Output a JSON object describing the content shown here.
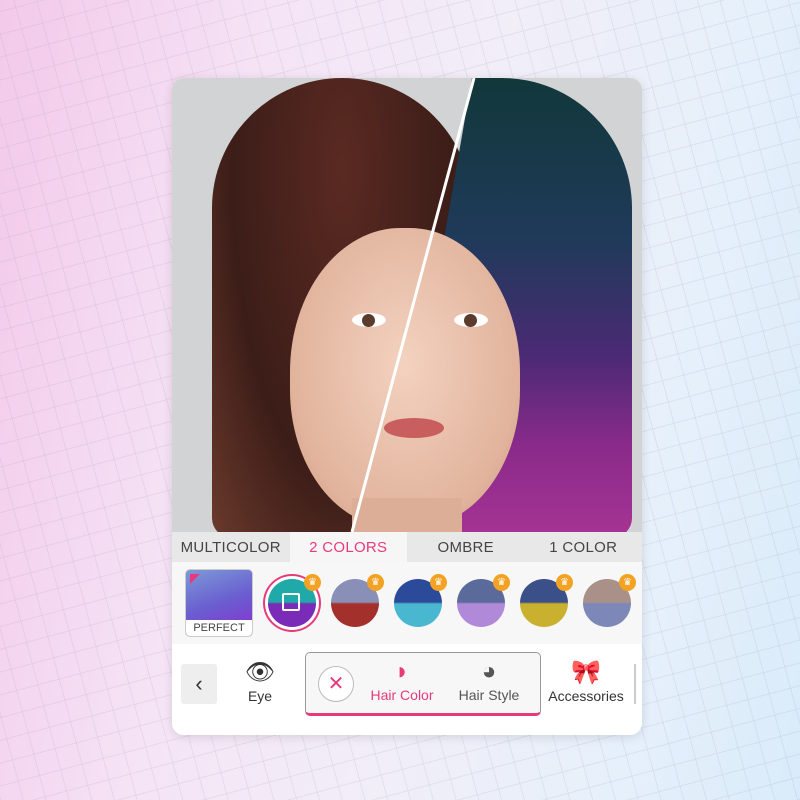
{
  "tabs": [
    {
      "label": "MULTICOLOR",
      "active": false
    },
    {
      "label": "2 COLORS",
      "active": true
    },
    {
      "label": "OMBRE",
      "active": false
    },
    {
      "label": "1 COLOR",
      "active": false
    }
  ],
  "swatches": {
    "perfect_label": "PERFECT",
    "items": [
      {
        "name": "teal-purple",
        "colors": [
          "#1fa9a8",
          "#7a2bb8"
        ],
        "premium": true,
        "selected": true
      },
      {
        "name": "lavender-red",
        "colors": [
          "#8a8fb8",
          "#a3302b"
        ],
        "premium": true,
        "selected": false
      },
      {
        "name": "blue-cyan",
        "colors": [
          "#2b4a9a",
          "#4ab7d0"
        ],
        "premium": true,
        "selected": false
      },
      {
        "name": "slate-violet",
        "colors": [
          "#5a6a9a",
          "#b08ad8"
        ],
        "premium": true,
        "selected": false
      },
      {
        "name": "navy-gold",
        "colors": [
          "#3b4f88",
          "#c9b02e"
        ],
        "premium": true,
        "selected": false
      },
      {
        "name": "taupe-periwinkle",
        "colors": [
          "#a99088",
          "#7d88b8"
        ],
        "premium": true,
        "selected": false
      }
    ]
  },
  "bottom": {
    "back_icon": "‹",
    "categories": [
      {
        "label": "Eye",
        "icon": "eye-icon",
        "glyph": "👁",
        "active": false
      },
      {
        "label": "Hair Color",
        "icon": "hair-color-icon",
        "glyph": "◗",
        "active": true
      },
      {
        "label": "Hair Style",
        "icon": "hair-style-icon",
        "glyph": "◕",
        "active": false
      },
      {
        "label": "Accessories",
        "icon": "bow-icon",
        "glyph": "🎀",
        "active": false
      }
    ],
    "clear_icon": "✕"
  },
  "colors": {
    "accent": "#e83a7b",
    "crown": "#f4a223"
  }
}
